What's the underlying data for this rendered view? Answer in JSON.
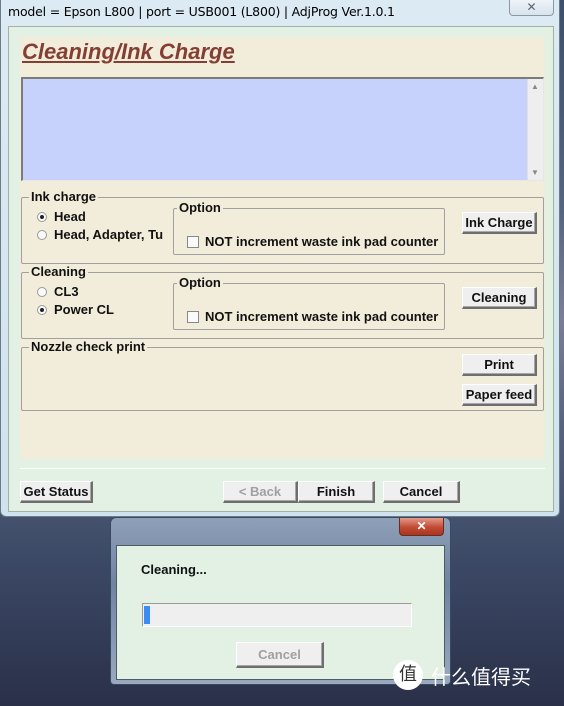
{
  "window": {
    "title": "model = Epson L800 | port = USB001 (L800) | AdjProg Ver.1.0.1",
    "close_glyph": "✕"
  },
  "page": {
    "title": "Cleaning/Ink Charge",
    "log_text": ""
  },
  "ink_charge": {
    "label": "Ink charge",
    "radios": [
      {
        "label": "Head",
        "checked": true
      },
      {
        "label": "Head, Adapter, Tu",
        "checked": false
      }
    ],
    "option_label": "Option",
    "option_checkbox": {
      "label": "NOT increment waste ink pad counter",
      "checked": false
    },
    "button": "Ink Charge"
  },
  "cleaning": {
    "label": "Cleaning",
    "radios": [
      {
        "label": "CL3",
        "checked": false
      },
      {
        "label": "Power CL",
        "checked": true
      }
    ],
    "option_label": "Option",
    "option_checkbox": {
      "label": "NOT increment waste ink pad counter",
      "checked": false
    },
    "button": "Cleaning"
  },
  "nozzle": {
    "label": "Nozzle check print",
    "print_button": "Print",
    "paper_feed_button": "Paper feed"
  },
  "footer": {
    "get_status": "Get Status",
    "back": "< Back",
    "finish": "Finish",
    "cancel": "Cancel"
  },
  "dialog": {
    "close_glyph": "✕",
    "message": "Cleaning...",
    "progress_percent": 2,
    "progress_color": "#3b8df5",
    "cancel": "Cancel"
  },
  "watermark": {
    "logo_char": "值",
    "text": "什么值得买"
  }
}
